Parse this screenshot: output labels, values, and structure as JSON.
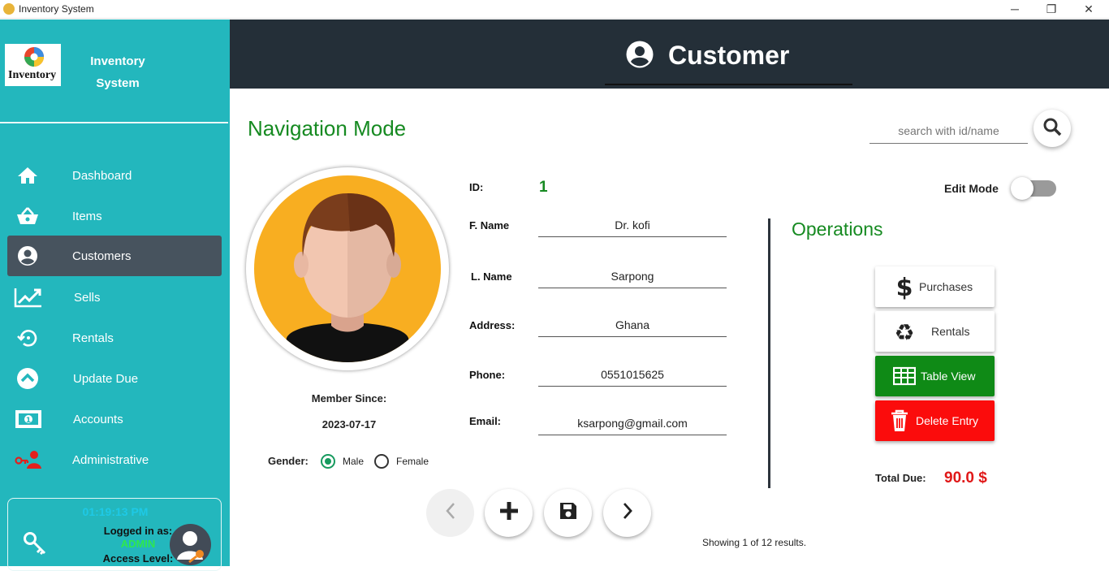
{
  "window": {
    "title": "Inventory System",
    "controls": {
      "minimize": "─",
      "maximize": "❐",
      "close": "✕"
    }
  },
  "sidebar": {
    "logo_text": "Inventory",
    "brand_line1": "Inventory",
    "brand_line2": "System",
    "items": [
      {
        "label": "Dashboard",
        "icon": "home-icon"
      },
      {
        "label": "Items",
        "icon": "basket-icon"
      },
      {
        "label": "Customers",
        "icon": "account-circle-icon",
        "active": true
      },
      {
        "label": "Sells",
        "icon": "trending-up-icon"
      },
      {
        "label": "Rentals",
        "icon": "history-icon"
      },
      {
        "label": "Update Due",
        "icon": "chevron-up-circle-icon"
      },
      {
        "label": "Accounts",
        "icon": "cash-icon"
      },
      {
        "label": "Administrative",
        "icon": "admin-key-user-icon"
      }
    ],
    "user_box": {
      "time": "01:19:13 PM",
      "logged_label": "Logged in as:",
      "username": "ADMIN",
      "access_label": "Access Level:"
    }
  },
  "header": {
    "title": "Customer",
    "icon": "account-circle-icon"
  },
  "main": {
    "mode_title": "Navigation Mode",
    "search": {
      "placeholder": "search with id/name",
      "value": ""
    },
    "member_since_label": "Member Since:",
    "member_since_value": "2023-07-17",
    "gender": {
      "label": "Gender:",
      "options": [
        "Male",
        "Female"
      ],
      "selected": "Male"
    },
    "fields": {
      "id_label": "ID:",
      "id_value": "1",
      "fname_label": "F. Name",
      "fname_value": "Dr. kofi",
      "lname_label": "L. Name",
      "lname_value": "Sarpong",
      "address_label": "Address:",
      "address_value": "Ghana",
      "phone_label": "Phone:",
      "phone_value": "0551015625",
      "email_label": "Email:",
      "email_value": "ksarpong@gmail.com"
    },
    "edit_mode": {
      "label": "Edit Mode",
      "on": false
    },
    "operations": {
      "title": "Operations",
      "purchases": "Purchases",
      "rentals": "Rentals",
      "table_view": "Table View",
      "delete_entry": "Delete Entry"
    },
    "total_due": {
      "label": "Total Due:",
      "value": "90.0 $"
    },
    "results_text": "Showing 1 of 12 results."
  },
  "colors": {
    "sidebar": "#23b7bd",
    "header": "#242f38",
    "accent_green": "#168a21",
    "delete_red": "#fb0c0c",
    "table_green": "#0f8a16",
    "due_red": "#e01818"
  }
}
